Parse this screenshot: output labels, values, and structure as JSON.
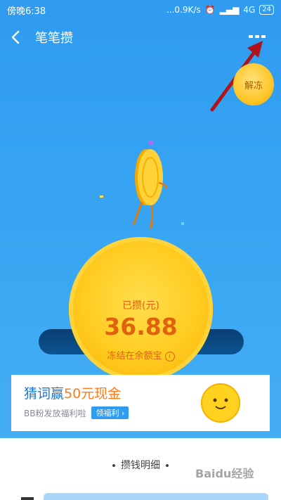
{
  "status_bar": {
    "time": "傍晚6:38",
    "speed": "...0.9K/s",
    "network": "4G",
    "battery": "24"
  },
  "nav": {
    "title": "笔笔攒"
  },
  "unfreeze": {
    "label": "解冻"
  },
  "coin": {
    "label": "已攒(元)",
    "amount": "36.88",
    "note": "冻结在余额宝",
    "info_glyph": "i"
  },
  "banner": {
    "title_prefix": "猜词赢",
    "title_highlight": "50元现金",
    "subtitle": "BB粉发放福利啦",
    "button_label": "领福利 ›"
  },
  "section": {
    "title": "攒钱明细"
  },
  "watermark": {
    "text": "Baidu经验"
  },
  "colors": {
    "brand_blue": "#2f9cf0",
    "coin_gold": "#ffcb1f",
    "amount_orange": "#e0620e",
    "arrow_red": "#b0141b"
  }
}
